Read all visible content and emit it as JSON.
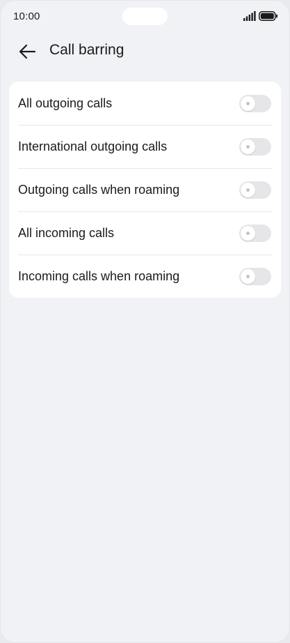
{
  "status_bar": {
    "time": "10:00",
    "signal_icon": "signal-bars-icon",
    "battery_icon": "battery-icon"
  },
  "header": {
    "back_icon": "arrow-left-icon",
    "title": "Call barring"
  },
  "settings": {
    "items": [
      {
        "label": "All outgoing calls",
        "enabled": false
      },
      {
        "label": "International outgoing calls",
        "enabled": false
      },
      {
        "label": "Outgoing calls when roaming",
        "enabled": false
      },
      {
        "label": "All incoming calls",
        "enabled": false
      },
      {
        "label": "Incoming calls when roaming",
        "enabled": false
      }
    ]
  },
  "colors": {
    "background": "#f1f2f6",
    "card": "#ffffff",
    "toggle_off": "#e6e6e8",
    "text": "#1a1a1a"
  }
}
